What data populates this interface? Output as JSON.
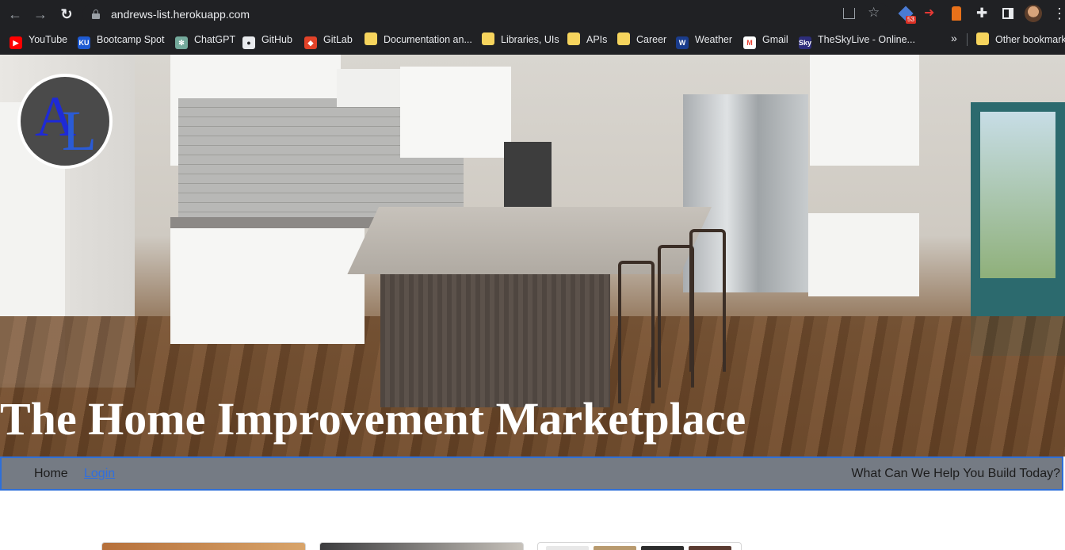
{
  "browser": {
    "url": "andrews-list.herokuapp.com",
    "extension_badge": "53",
    "bookmarks": [
      {
        "label": "YouTube",
        "icon": "youtube-icon",
        "glyph": "▶"
      },
      {
        "label": "Bootcamp Spot",
        "icon": "ku-icon",
        "glyph": "KU"
      },
      {
        "label": "ChatGPT",
        "icon": "chatgpt-icon",
        "glyph": "✻"
      },
      {
        "label": "GitHub",
        "icon": "github-icon",
        "glyph": "●"
      },
      {
        "label": "GitLab",
        "icon": "gitlab-icon",
        "glyph": "◆"
      },
      {
        "label": "Documentation an...",
        "icon": "folder-icon",
        "glyph": ""
      },
      {
        "label": "Libraries, UIs",
        "icon": "folder-icon",
        "glyph": ""
      },
      {
        "label": "APIs",
        "icon": "folder-icon",
        "glyph": ""
      },
      {
        "label": "Career",
        "icon": "folder-icon",
        "glyph": ""
      },
      {
        "label": "Weather",
        "icon": "weather-icon",
        "glyph": "W"
      },
      {
        "label": "Gmail",
        "icon": "gmail-icon",
        "glyph": "M"
      },
      {
        "label": "TheSkyLive - Online...",
        "icon": "skylive-icon",
        "glyph": "Sky"
      }
    ],
    "other_bookmarks": "Other bookmarks"
  },
  "hero": {
    "logo_letter_1": "A",
    "logo_letter_2": "L",
    "title": "The Home Improvement Marketplace"
  },
  "navbar": {
    "home": "Home",
    "login": "Login",
    "tagline": "What Can We Help You Build Today?"
  },
  "colors": {
    "chrome_bg": "#202124",
    "navbar_bg": "#757b84",
    "navbar_border": "#2e6fd8",
    "link": "#2f6fe0",
    "logo_blue": "#1e2ad6"
  }
}
